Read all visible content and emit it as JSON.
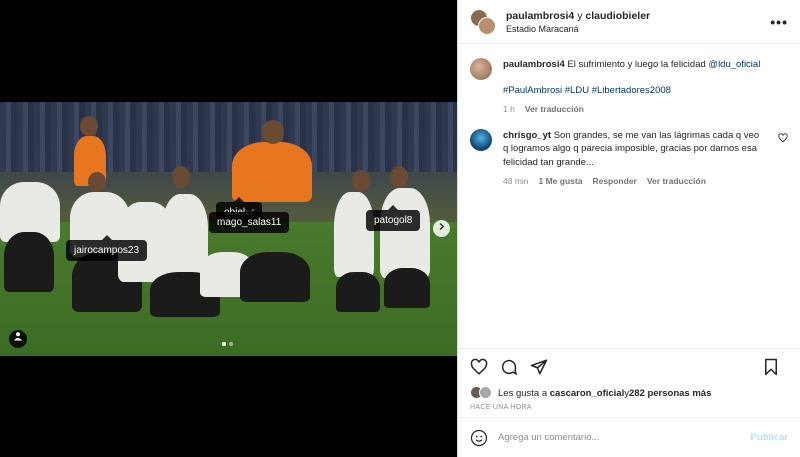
{
  "media": {
    "tags": [
      "mago_salas11",
      "paulambrosi4 y claudiobieler",
      "patogol8",
      "jairocampos23"
    ],
    "tag_overlap_text": "obieler",
    "carousel_count": 2,
    "carousel_active": 1,
    "next_icon": "chevron-right-icon",
    "user_tag_icon": "person-icon"
  },
  "header": {
    "user1": "paulambrosi4",
    "connector": " y ",
    "user2": "claudiobieler",
    "location": "Estadio Maracaná",
    "more_icon": "•••"
  },
  "caption": {
    "username": "paulambrosi4",
    "text": "El sufrimiento y luego la felicidad",
    "mention": "@ldu_oficial",
    "hashtags": "#PaulAmbrosi #LDU #Libertadores2008",
    "time": "1 h",
    "translate": "Ver traducción"
  },
  "comment": {
    "username": "chrisgo_yt",
    "text": "Son grandes, se me van las lágrimas cada q veo q logramos algo q parecia imposible, gracias por darnos esa felicidad tan grande...",
    "time": "48 min",
    "likes": "1 Me gusta",
    "reply": "Responder",
    "translate": "Ver traducción"
  },
  "likes": {
    "prefix": "Les gusta a",
    "user": "cascaron_oficial",
    "connector": " y ",
    "others": "282 personas más"
  },
  "timestamp": "HACE UNA HORA",
  "add_comment": {
    "placeholder": "Agrega un comentario...",
    "post_label": "Publicar"
  },
  "colors": {
    "link": "#00376b",
    "post_disabled": "#b2dffc",
    "secondary_text": "#8e8e8e"
  }
}
